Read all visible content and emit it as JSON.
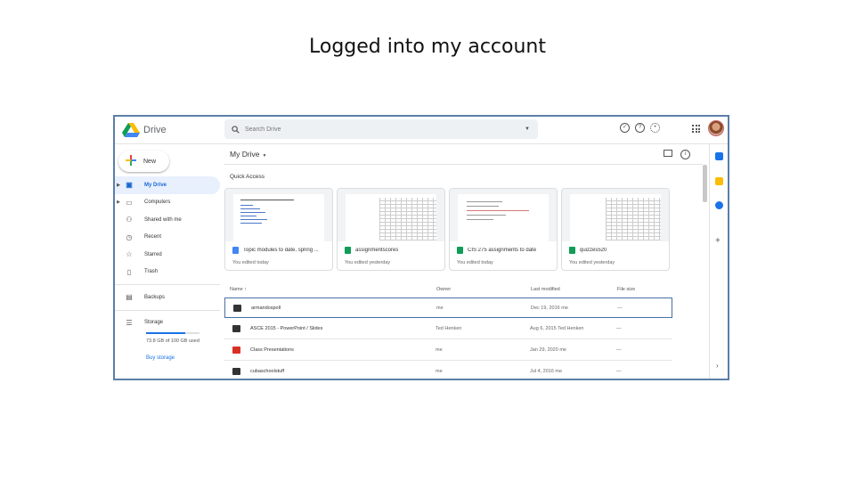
{
  "slide": {
    "title": "Logged into my account"
  },
  "app": {
    "name": "Drive"
  },
  "search": {
    "placeholder": "Search Drive"
  },
  "sidebar": {
    "new_label": "New",
    "items": [
      {
        "label": "My Drive",
        "icon": "drive-folder-icon",
        "active": true
      },
      {
        "label": "Computers",
        "icon": "computer-icon"
      },
      {
        "label": "Shared with me",
        "icon": "people-icon"
      },
      {
        "label": "Recent",
        "icon": "clock-icon"
      },
      {
        "label": "Starred",
        "icon": "star-icon"
      },
      {
        "label": "Trash",
        "icon": "trash-icon"
      }
    ],
    "backups": "Backups",
    "storage": {
      "label": "Storage",
      "used_text": "73.8 GB of 100 GB used",
      "used_fraction": 0.738,
      "buy": "Buy storage"
    }
  },
  "main": {
    "location": "My Drive",
    "quick_access": "Quick Access",
    "cards": [
      {
        "title": "Topic modules to date, spring ...",
        "sub": "You edited today",
        "type": "doc",
        "color": "#4285f4"
      },
      {
        "title": "assignmentscores",
        "sub": "You edited yesterday",
        "type": "sheet",
        "color": "#0f9d58"
      },
      {
        "title": "CIS 275 assignments to date",
        "sub": "You edited today",
        "type": "sheet",
        "color": "#0f9d58"
      },
      {
        "title": "quizzes520",
        "sub": "You edited yesterday",
        "type": "sheet",
        "color": "#0f9d58"
      }
    ],
    "columns": {
      "name": "Name",
      "owner": "Owner",
      "modified": "Last modified",
      "size": "File size"
    },
    "rows": [
      {
        "name": "armandospoll",
        "owner": "me",
        "modified": "Dec 19, 2016 me",
        "size": "—",
        "color": "#333333",
        "selected": true
      },
      {
        "name": "ASCE 2015 - PowerPoint / Slides",
        "owner": "Ted Henken",
        "modified": "Aug 6, 2015 Ted Henken",
        "size": "—",
        "color": "#333333"
      },
      {
        "name": "Class Presentations",
        "owner": "me",
        "modified": "Jan 29, 2020 me",
        "size": "—",
        "color": "#d93025"
      },
      {
        "name": "cubaschoolstuff",
        "owner": "me",
        "modified": "Jul 4, 2016 me",
        "size": "—",
        "color": "#333333"
      }
    ]
  },
  "colors": {
    "accent": "#1a73e8",
    "active_bg": "#e8f0fe",
    "frame_border": "#5b7fa8"
  }
}
